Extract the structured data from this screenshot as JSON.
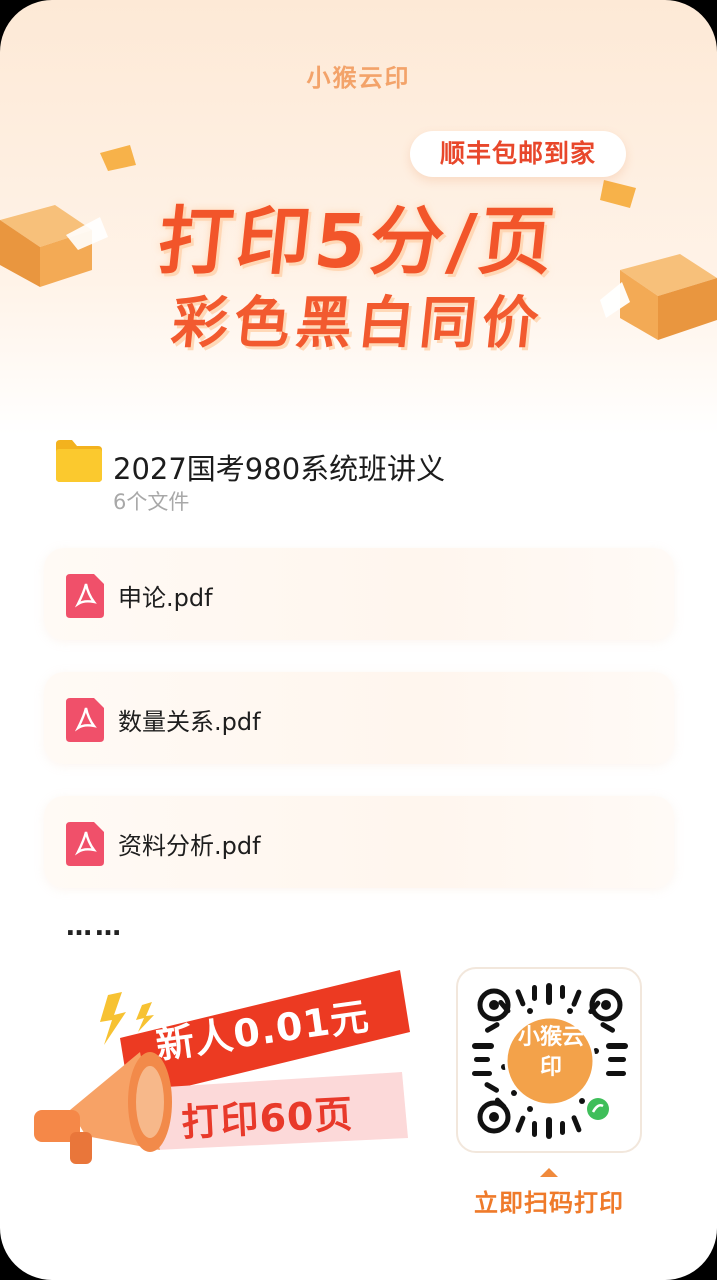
{
  "header": {
    "brand": "小猴云印",
    "shipping_badge": "顺丰包邮到家",
    "headline": "打印5分/页",
    "subline": "彩色黑白同价"
  },
  "folder": {
    "title": "2027国考980系统班讲义",
    "count": "6个文件",
    "icon": "folder-icon"
  },
  "files": [
    {
      "name": "申论.pdf",
      "icon": "pdf-icon"
    },
    {
      "name": "数量关系.pdf",
      "icon": "pdf-icon"
    },
    {
      "name": "资料分析.pdf",
      "icon": "pdf-icon"
    }
  ],
  "more": "……",
  "promo": {
    "line1": "新人0.01元",
    "line2": "打印60页"
  },
  "qr": {
    "center_text": "小猴云印",
    "cta": "立即扫码打印"
  },
  "colors": {
    "accent": "#f2552a",
    "orange": "#f08a3c",
    "pdf_red": "#f0506a",
    "folder_yellow": "#fbc530"
  }
}
